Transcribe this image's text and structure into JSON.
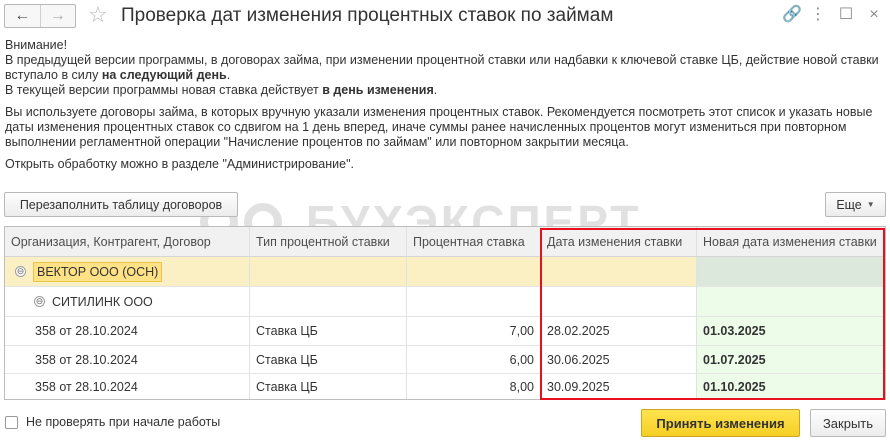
{
  "window": {
    "title": "Проверка дат изменения процентных ставок по займам",
    "back_glyph": "←",
    "forward_glyph": "→",
    "star_glyph": "☆",
    "link_glyph": "🔗",
    "menu_glyph": "⋮",
    "maximize_glyph": "☐",
    "close_glyph": "×"
  },
  "notice": {
    "heading": "Внимание!",
    "p1_a": "В предыдущей версии программы, в договорах займа, при изменении процентной ставки или надбавки к ключевой ставке ЦБ, действие новой ставки вступало в силу ",
    "p1_b": "на следующий день",
    "p1_c": ".",
    "p2_a": "В текущей версии программы новая ставка действует ",
    "p2_b": "в день изменения",
    "p2_c": ".",
    "p3": "Вы используете договоры займа, в которых вручную указали изменения процентных ставок. Рекомендуется посмотреть этот список и указать новые даты изменения процентных ставок со сдвигом на 1 день вперед, иначе суммы ранее начисленных процентов могут измениться при повторном выполнении регламентной операции \"Начисление процентов по займам\" или повторном закрытии месяца.",
    "p4": "Открыть обработку можно в разделе \"Администрирование\"."
  },
  "toolbar": {
    "refill_label": "Перезаполнить таблицу договоров",
    "more_label": "Еще",
    "more_caret": "▼"
  },
  "watermark": {
    "text": "БУХЭКСПЕРТ"
  },
  "table": {
    "columns": [
      "Организация, Контрагент, Договор",
      "Тип процентной ставки",
      "Процентная ставка",
      "Дата изменения ставки",
      "Новая дата изменения ставки"
    ],
    "organization": "ВЕКТОР ООО (ОСН)",
    "counterparty": "СИТИЛИНК ООО",
    "toggle_glyph": "⊖",
    "rows": [
      {
        "contract": "358 от 28.10.2024",
        "rate_type": "Ставка ЦБ",
        "rate": "7,00",
        "date": "28.02.2025",
        "new_date": "01.03.2025"
      },
      {
        "contract": "358 от 28.10.2024",
        "rate_type": "Ставка ЦБ",
        "rate": "6,00",
        "date": "30.06.2025",
        "new_date": "01.07.2025"
      },
      {
        "contract": "358 от 28.10.2024",
        "rate_type": "Ставка ЦБ",
        "rate": "8,00",
        "date": "30.09.2025",
        "new_date": "01.10.2025"
      }
    ]
  },
  "footer": {
    "checkbox_label": "Не проверять при начале работы",
    "checkbox_checked": false,
    "accept_label": "Принять изменения",
    "close_label": "Закрыть"
  },
  "colors": {
    "accent_button": "#f5cf24",
    "highlight_row": "#fbf0c4",
    "new_date_column": "#edfbe9",
    "red_frame": "#e8101c"
  }
}
